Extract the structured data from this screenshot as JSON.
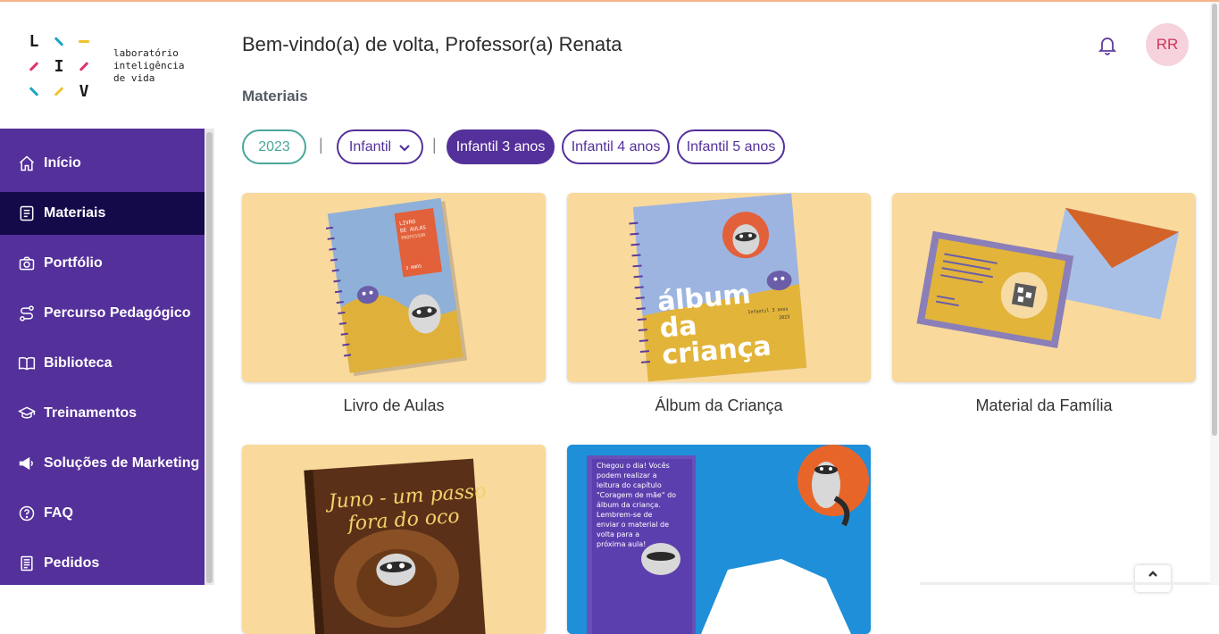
{
  "logo": {
    "letters": [
      "L",
      "I",
      "V"
    ],
    "text_lines": [
      "laboratório",
      "inteligência",
      "de vida"
    ]
  },
  "sidebar": {
    "items": [
      {
        "label": "Início",
        "icon": "home-icon"
      },
      {
        "label": "Materiais",
        "icon": "document-icon",
        "active": true
      },
      {
        "label": "Portfólio",
        "icon": "camera-icon"
      },
      {
        "label": "Percurso Pedagógico",
        "icon": "route-icon"
      },
      {
        "label": "Biblioteca",
        "icon": "book-icon"
      },
      {
        "label": "Treinamentos",
        "icon": "graduation-cap-icon"
      },
      {
        "label": "Soluções de Marketing",
        "icon": "megaphone-icon"
      },
      {
        "label": "FAQ",
        "icon": "question-icon"
      },
      {
        "label": "Pedidos",
        "icon": "receipt-icon"
      }
    ]
  },
  "header": {
    "greeting": "Bem-vindo(a) de volta, Professor(a) Renata",
    "avatar_initials": "RR"
  },
  "main": {
    "section_title": "Materiais",
    "filters": {
      "year": "2023",
      "segment": "Infantil",
      "separator": "|",
      "levels": [
        "Infantil 3 anos",
        "Infantil 4 anos",
        "Infantil 5 anos"
      ],
      "selected_level": "Infantil 3 anos"
    },
    "cards": [
      {
        "title": "Livro de Aulas"
      },
      {
        "title": "Álbum da Criança"
      },
      {
        "title": "Material da Família"
      },
      {
        "title": ""
      },
      {
        "title": ""
      }
    ],
    "card_art_text": {
      "livro_cover": [
        "LIVRO",
        "DE AULAS",
        "PROFESSOR",
        "3 ANOS"
      ],
      "album_cover": [
        "álbum",
        "da",
        "criança",
        "Infantil 3 anos",
        "2023"
      ],
      "juno_book": [
        "Juno - um passo",
        "fora do oco"
      ],
      "blue_post": [
        "Chegou o dia! Vocês",
        "podem realizar a",
        "leitura do capítulo",
        "\"Coragem de mãe\" do",
        "álbum da criança.",
        "Lembrem-se de",
        "enviar o material de",
        "volta para a",
        "próxima aula!"
      ]
    }
  },
  "colors": {
    "brand_purple": "#54309a",
    "active_nav": "#140a4a",
    "teal": "#4aa79a",
    "card_bg": "#f9d99c",
    "avatar_bg": "#f6d3dc",
    "avatar_text": "#d1325b"
  }
}
